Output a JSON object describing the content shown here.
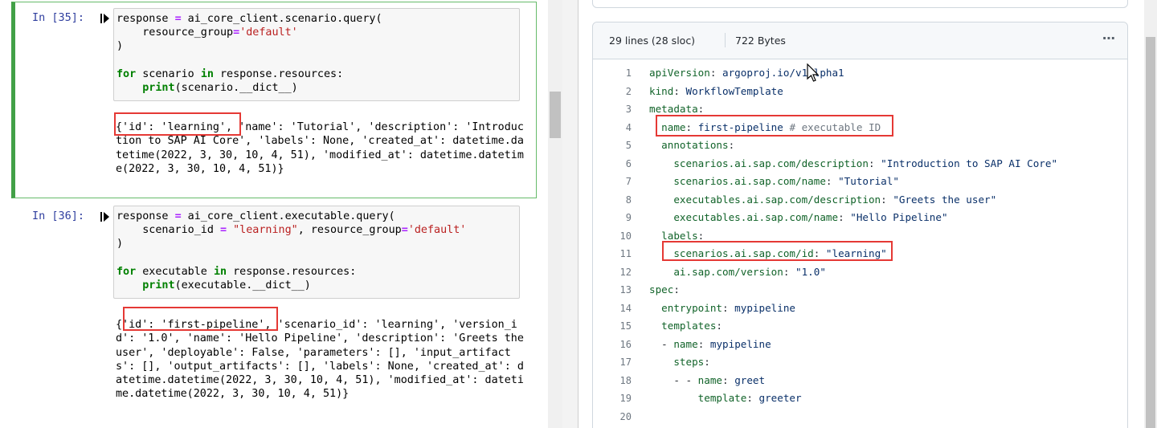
{
  "notebook": {
    "cell35": {
      "prompt": "In [35]:",
      "code": [
        [
          {
            "t": "response "
          },
          {
            "t": "=",
            "c": "op"
          },
          {
            "t": " ai_core_client.scenario.query("
          }
        ],
        [
          {
            "t": "    resource_group"
          },
          {
            "t": "=",
            "c": "op"
          },
          {
            "t": "'default'",
            "c": "str"
          }
        ],
        [
          {
            "t": ")"
          }
        ],
        [
          {
            "t": ""
          }
        ],
        [
          {
            "t": "for",
            "c": "kw"
          },
          {
            "t": " scenario "
          },
          {
            "t": "in",
            "c": "kw"
          },
          {
            "t": " response.resources:"
          }
        ],
        [
          {
            "t": "    "
          },
          {
            "t": "print",
            "c": "kw"
          },
          {
            "t": "(scenario.__dict__)"
          }
        ]
      ],
      "output": "{'id': 'learning', 'name': 'Tutorial', 'description': 'Introduc\ntion to SAP AI Core', 'labels': None, 'created_at': datetime.da\ntetime(2022, 3, 30, 10, 4, 51), 'modified_at': datetime.datetim\ne(2022, 3, 30, 10, 4, 51)}"
    },
    "cell36": {
      "prompt": "In [36]:",
      "code": [
        [
          {
            "t": "response "
          },
          {
            "t": "=",
            "c": "op"
          },
          {
            "t": " ai_core_client.executable.query("
          }
        ],
        [
          {
            "t": "    scenario_id "
          },
          {
            "t": "=",
            "c": "op"
          },
          {
            "t": " "
          },
          {
            "t": "\"learning\"",
            "c": "str"
          },
          {
            "t": ", resource_group"
          },
          {
            "t": "=",
            "c": "op"
          },
          {
            "t": "'default'",
            "c": "str"
          }
        ],
        [
          {
            "t": ")"
          }
        ],
        [
          {
            "t": ""
          }
        ],
        [
          {
            "t": "for",
            "c": "kw"
          },
          {
            "t": " executable "
          },
          {
            "t": "in",
            "c": "kw"
          },
          {
            "t": " response.resources:"
          }
        ],
        [
          {
            "t": "    "
          },
          {
            "t": "print",
            "c": "kw"
          },
          {
            "t": "(executable.__dict__)"
          }
        ]
      ],
      "output": "{'id': 'first-pipeline', 'scenario_id': 'learning', 'version_i\nd': '1.0', 'name': 'Hello Pipeline', 'description': 'Greets the\nuser', 'deployable': False, 'parameters': [], 'input_artifact\ns': [], 'output_artifacts': [], 'labels': None, 'created_at': d\natetime.datetime(2022, 3, 30, 10, 4, 51), 'modified_at': dateti\nme.datetime(2022, 3, 30, 10, 4, 51)}"
    }
  },
  "viewer": {
    "lines_info": "29 lines (28 sloc)",
    "bytes_info": "722 Bytes",
    "more_icon": "⋯",
    "lines": [
      {
        "n": "1",
        "parts": [
          {
            "t": "apiVersion",
            "c": "k"
          },
          {
            "t": ": "
          },
          {
            "t": "argoproj.io/v1alpha1",
            "c": "s"
          }
        ]
      },
      {
        "n": "2",
        "parts": [
          {
            "t": "kind",
            "c": "k"
          },
          {
            "t": ": "
          },
          {
            "t": "WorkflowTemplate",
            "c": "s"
          }
        ]
      },
      {
        "n": "3",
        "parts": [
          {
            "t": "metadata",
            "c": "k"
          },
          {
            "t": ":"
          }
        ]
      },
      {
        "n": "4",
        "parts": [
          {
            "t": "  "
          },
          {
            "t": "name",
            "c": "k"
          },
          {
            "t": ": "
          },
          {
            "t": "first-pipeline",
            "c": "s"
          },
          {
            "t": " "
          },
          {
            "t": "# executable ID",
            "c": "c"
          }
        ]
      },
      {
        "n": "5",
        "parts": [
          {
            "t": "  "
          },
          {
            "t": "annotations",
            "c": "k"
          },
          {
            "t": ":"
          }
        ]
      },
      {
        "n": "6",
        "parts": [
          {
            "t": "    "
          },
          {
            "t": "scenarios.ai.sap.com/description",
            "c": "k"
          },
          {
            "t": ": "
          },
          {
            "t": "\"Introduction to SAP AI Core\"",
            "c": "s"
          }
        ]
      },
      {
        "n": "7",
        "parts": [
          {
            "t": "    "
          },
          {
            "t": "scenarios.ai.sap.com/name",
            "c": "k"
          },
          {
            "t": ": "
          },
          {
            "t": "\"Tutorial\"",
            "c": "s"
          }
        ]
      },
      {
        "n": "8",
        "parts": [
          {
            "t": "    "
          },
          {
            "t": "executables.ai.sap.com/description",
            "c": "k"
          },
          {
            "t": ": "
          },
          {
            "t": "\"Greets the user\"",
            "c": "s"
          }
        ]
      },
      {
        "n": "9",
        "parts": [
          {
            "t": "    "
          },
          {
            "t": "executables.ai.sap.com/name",
            "c": "k"
          },
          {
            "t": ": "
          },
          {
            "t": "\"Hello Pipeline\"",
            "c": "s"
          }
        ]
      },
      {
        "n": "10",
        "parts": [
          {
            "t": "  "
          },
          {
            "t": "labels",
            "c": "k"
          },
          {
            "t": ":"
          }
        ]
      },
      {
        "n": "11",
        "parts": [
          {
            "t": "    "
          },
          {
            "t": "scenarios.ai.sap.com/id",
            "c": "k"
          },
          {
            "t": ": "
          },
          {
            "t": "\"learning\"",
            "c": "s"
          }
        ]
      },
      {
        "n": "12",
        "parts": [
          {
            "t": "    "
          },
          {
            "t": "ai.sap.com/version",
            "c": "k"
          },
          {
            "t": ": "
          },
          {
            "t": "\"1.0\"",
            "c": "s"
          }
        ]
      },
      {
        "n": "13",
        "parts": [
          {
            "t": "spec",
            "c": "k"
          },
          {
            "t": ":"
          }
        ]
      },
      {
        "n": "14",
        "parts": [
          {
            "t": "  "
          },
          {
            "t": "entrypoint",
            "c": "k"
          },
          {
            "t": ": "
          },
          {
            "t": "mypipeline",
            "c": "s"
          }
        ]
      },
      {
        "n": "15",
        "parts": [
          {
            "t": "  "
          },
          {
            "t": "templates",
            "c": "k"
          },
          {
            "t": ":"
          }
        ]
      },
      {
        "n": "16",
        "parts": [
          {
            "t": "  - "
          },
          {
            "t": "name",
            "c": "k"
          },
          {
            "t": ": "
          },
          {
            "t": "mypipeline",
            "c": "s"
          }
        ]
      },
      {
        "n": "17",
        "parts": [
          {
            "t": "    "
          },
          {
            "t": "steps",
            "c": "k"
          },
          {
            "t": ":"
          }
        ]
      },
      {
        "n": "18",
        "parts": [
          {
            "t": "    - - "
          },
          {
            "t": "name",
            "c": "k"
          },
          {
            "t": ": "
          },
          {
            "t": "greet",
            "c": "s"
          }
        ]
      },
      {
        "n": "19",
        "parts": [
          {
            "t": "        "
          },
          {
            "t": "template",
            "c": "k"
          },
          {
            "t": ": "
          },
          {
            "t": "greeter",
            "c": "s"
          }
        ]
      },
      {
        "n": "20",
        "parts": [
          {
            "t": ""
          }
        ]
      }
    ]
  },
  "colors": {
    "highlight_box": "#e53935",
    "selected_cell_border": "#42a047",
    "prompt": "#303f9f"
  }
}
